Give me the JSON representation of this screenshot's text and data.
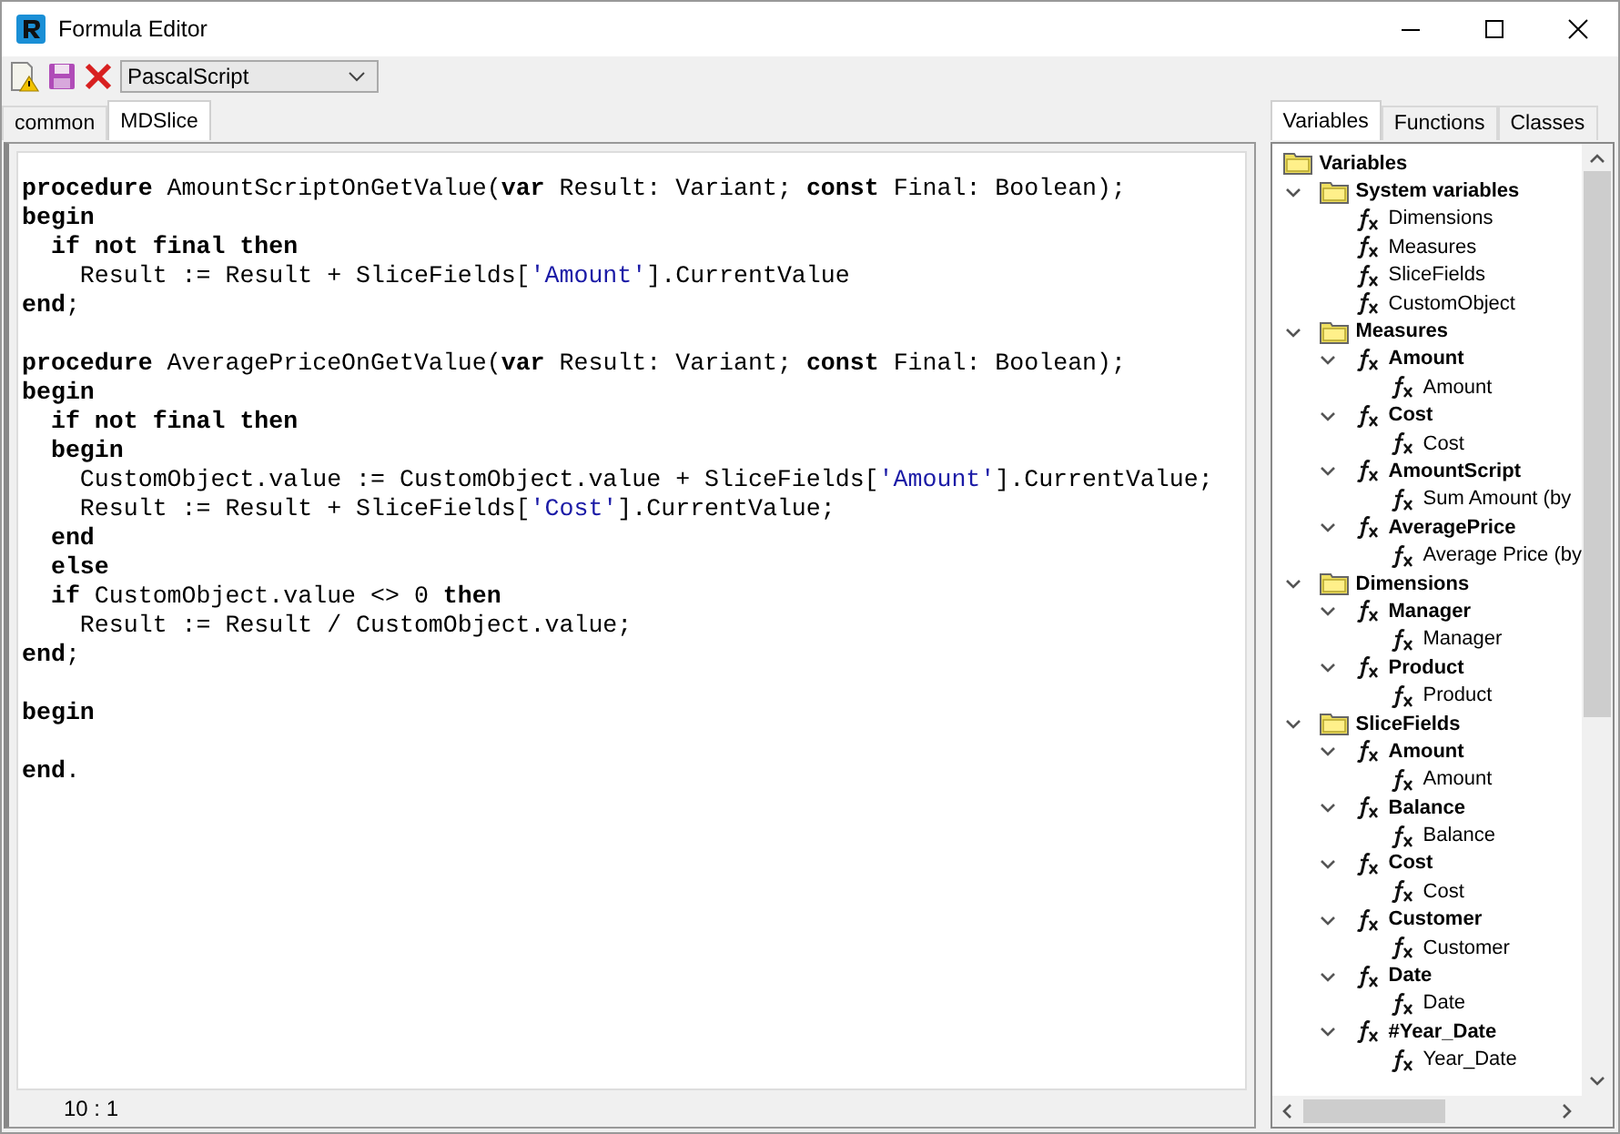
{
  "window": {
    "title": "Formula Editor"
  },
  "toolbar": {
    "language": "PascalScript"
  },
  "editor_tabs": [
    {
      "label": "common",
      "selected": false
    },
    {
      "label": "MDSlice",
      "selected": true
    }
  ],
  "code_lines": [
    {
      "kind": "code",
      "tokens": [
        {
          "kind": "keyword",
          "text": "procedure"
        },
        {
          "kind": "plain",
          "text": " AmountScriptOnGetValue("
        },
        {
          "kind": "keyword",
          "text": "var"
        },
        {
          "kind": "plain",
          "text": " Result: Variant; "
        },
        {
          "kind": "keyword",
          "text": "const"
        },
        {
          "kind": "plain",
          "text": " Final: Boolean);"
        }
      ]
    },
    {
      "kind": "code",
      "tokens": [
        {
          "kind": "keyword",
          "text": "begin"
        }
      ]
    },
    {
      "kind": "code",
      "tokens": [
        {
          "kind": "keyword",
          "text": "  if not final then"
        }
      ]
    },
    {
      "kind": "code",
      "tokens": [
        {
          "kind": "plain",
          "text": "    Result := Result + SliceFields["
        },
        {
          "kind": "string",
          "text": "'Amount'"
        },
        {
          "kind": "plain",
          "text": "].CurrentValue"
        }
      ]
    },
    {
      "kind": "code",
      "tokens": [
        {
          "kind": "keyword",
          "text": "end"
        },
        {
          "kind": "plain",
          "text": ";"
        }
      ]
    },
    {
      "kind": "blank"
    },
    {
      "kind": "code",
      "tokens": [
        {
          "kind": "keyword",
          "text": "procedure"
        },
        {
          "kind": "plain",
          "text": " AveragePriceOnGetValue("
        },
        {
          "kind": "keyword",
          "text": "var"
        },
        {
          "kind": "plain",
          "text": " Result: Variant; "
        },
        {
          "kind": "keyword",
          "text": "const"
        },
        {
          "kind": "plain",
          "text": " Final: Boolean);"
        }
      ]
    },
    {
      "kind": "code",
      "tokens": [
        {
          "kind": "keyword",
          "text": "begin"
        }
      ]
    },
    {
      "kind": "code",
      "tokens": [
        {
          "kind": "keyword",
          "text": "  if not final then"
        }
      ]
    },
    {
      "kind": "code",
      "tokens": [
        {
          "kind": "keyword",
          "text": "  begin"
        }
      ]
    },
    {
      "kind": "code",
      "tokens": [
        {
          "kind": "plain",
          "text": "    CustomObject.value := CustomObject.value + SliceFields["
        },
        {
          "kind": "string",
          "text": "'Amount'"
        },
        {
          "kind": "plain",
          "text": "].CurrentValue;"
        }
      ]
    },
    {
      "kind": "code",
      "tokens": [
        {
          "kind": "plain",
          "text": "    Result := Result + SliceFields["
        },
        {
          "kind": "string",
          "text": "'Cost'"
        },
        {
          "kind": "plain",
          "text": "].CurrentValue;"
        }
      ]
    },
    {
      "kind": "code",
      "tokens": [
        {
          "kind": "keyword",
          "text": "  end"
        }
      ]
    },
    {
      "kind": "code",
      "tokens": [
        {
          "kind": "keyword",
          "text": "  else"
        }
      ]
    },
    {
      "kind": "code",
      "tokens": [
        {
          "kind": "keyword",
          "text": "  if"
        },
        {
          "kind": "plain",
          "text": " CustomObject.value <> 0 "
        },
        {
          "kind": "keyword",
          "text": "then"
        }
      ]
    },
    {
      "kind": "code",
      "tokens": [
        {
          "kind": "plain",
          "text": "    Result := Result / CustomObject.value;"
        }
      ]
    },
    {
      "kind": "code",
      "tokens": [
        {
          "kind": "keyword",
          "text": "end"
        },
        {
          "kind": "plain",
          "text": ";"
        }
      ]
    },
    {
      "kind": "blank"
    },
    {
      "kind": "code",
      "tokens": [
        {
          "kind": "keyword",
          "text": "begin"
        }
      ]
    },
    {
      "kind": "blank"
    },
    {
      "kind": "code",
      "tokens": [
        {
          "kind": "keyword",
          "text": "end"
        },
        {
          "kind": "plain",
          "text": "."
        }
      ]
    }
  ],
  "status_bar": {
    "cursor": "10 : 1"
  },
  "side_tabs": [
    {
      "label": "Variables",
      "selected": true
    },
    {
      "label": "Functions",
      "selected": false
    },
    {
      "label": "Classes",
      "selected": false
    }
  ],
  "tree": {
    "kind": "root",
    "label": "Variables",
    "children": [
      {
        "kind": "folder",
        "label": "System variables",
        "expanded": true,
        "children": [
          {
            "kind": "value",
            "label": "Dimensions"
          },
          {
            "kind": "value",
            "label": "Measures"
          },
          {
            "kind": "value",
            "label": "SliceFields"
          },
          {
            "kind": "value",
            "label": "CustomObject"
          }
        ]
      },
      {
        "kind": "folder",
        "label": "Measures",
        "expanded": true,
        "children": [
          {
            "kind": "field",
            "label": "Amount",
            "expanded": true,
            "children": [
              {
                "kind": "value",
                "label": "Amount"
              }
            ]
          },
          {
            "kind": "field",
            "label": "Cost",
            "expanded": true,
            "children": [
              {
                "kind": "value",
                "label": "Cost"
              }
            ]
          },
          {
            "kind": "field",
            "label": "AmountScript",
            "expanded": true,
            "children": [
              {
                "kind": "value",
                "label": "Sum Amount (by"
              }
            ]
          },
          {
            "kind": "field",
            "label": "AveragePrice",
            "expanded": true,
            "children": [
              {
                "kind": "value",
                "label": "Average Price (by"
              }
            ]
          }
        ]
      },
      {
        "kind": "folder",
        "label": "Dimensions",
        "expanded": true,
        "children": [
          {
            "kind": "field",
            "label": "Manager",
            "expanded": true,
            "children": [
              {
                "kind": "value",
                "label": "Manager"
              }
            ]
          },
          {
            "kind": "field",
            "label": "Product",
            "expanded": true,
            "children": [
              {
                "kind": "value",
                "label": "Product"
              }
            ]
          }
        ]
      },
      {
        "kind": "folder",
        "label": "SliceFields",
        "expanded": true,
        "children": [
          {
            "kind": "field",
            "label": "Amount",
            "expanded": true,
            "children": [
              {
                "kind": "value",
                "label": "Amount"
              }
            ]
          },
          {
            "kind": "field",
            "label": "Balance",
            "expanded": true,
            "children": [
              {
                "kind": "value",
                "label": "Balance"
              }
            ]
          },
          {
            "kind": "field",
            "label": "Cost",
            "expanded": true,
            "children": [
              {
                "kind": "value",
                "label": "Cost"
              }
            ]
          },
          {
            "kind": "field",
            "label": "Customer",
            "expanded": true,
            "children": [
              {
                "kind": "value",
                "label": "Customer"
              }
            ]
          },
          {
            "kind": "field",
            "label": "Date",
            "expanded": true,
            "children": [
              {
                "kind": "value",
                "label": "Date"
              }
            ]
          },
          {
            "kind": "field",
            "label": "#Year_Date",
            "expanded": true,
            "children": [
              {
                "kind": "value",
                "label": "Year_Date"
              }
            ]
          }
        ]
      }
    ]
  }
}
